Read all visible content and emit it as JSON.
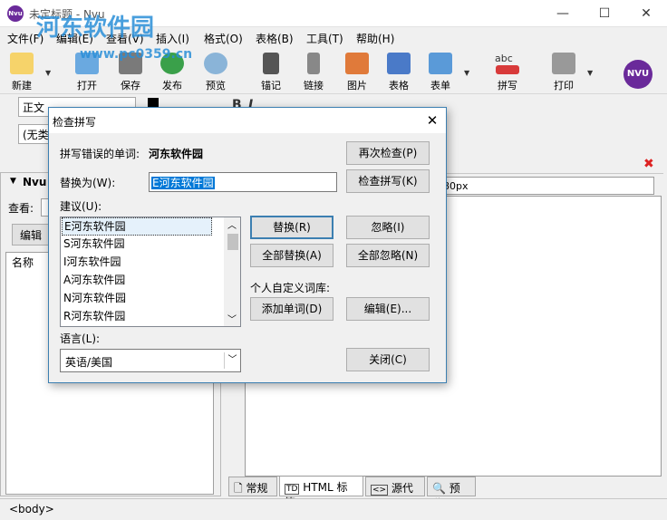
{
  "window": {
    "title": "未定标题 - Nvu",
    "logo": "Nvu",
    "minimize": "—",
    "maximize": "☐",
    "close": "✕"
  },
  "watermark": {
    "main": "河东软件园",
    "url": "www.pc0359.cn"
  },
  "menu": [
    "文件(F)",
    "编辑(E)",
    "查看(V)",
    "插入(I)",
    "格式(O)",
    "表格(B)",
    "工具(T)",
    "帮助(H)"
  ],
  "toolbar": [
    {
      "label": "新建",
      "icon": "new-page-icon",
      "color": "#f6d36a"
    },
    {
      "label": "打开",
      "icon": "open-folder-icon",
      "color": "#6aa9e0"
    },
    {
      "label": "保存",
      "icon": "save-disk-icon",
      "color": "#7a7a7a"
    },
    {
      "label": "发布",
      "icon": "publish-globe-icon",
      "color": "#3aa04a"
    },
    {
      "label": "预览",
      "icon": "preview-magnifier-icon",
      "color": "#8ab4d8"
    },
    {
      "label": "锚记",
      "icon": "anchor-icon",
      "color": "#555555"
    },
    {
      "label": "链接",
      "icon": "link-chain-icon",
      "color": "#888888"
    },
    {
      "label": "图片",
      "icon": "image-icon",
      "color": "#e07a3a"
    },
    {
      "label": "表格",
      "icon": "table-icon",
      "color": "#4a7ac8"
    },
    {
      "label": "表单",
      "icon": "form-icon",
      "color": "#5a9ad8"
    },
    {
      "label": "拼写",
      "icon": "spell-check-icon",
      "color": "#d83a3a"
    },
    {
      "label": "打印",
      "icon": "printer-icon",
      "color": "#999999"
    }
  ],
  "toolbar_extra": {
    "spell_abc": "abc",
    "nvu_logo": "NVU"
  },
  "format": {
    "paragraph_style": "正文",
    "second_style": "(无类",
    "bold": "B",
    "italic": "I"
  },
  "left_panel": {
    "title": "Nvu",
    "view_label": "查看:",
    "edit_button": "编辑",
    "column_name": "名称"
  },
  "editor": {
    "px_value": "80px"
  },
  "bottom_tabs": [
    "常规",
    "HTML 标签",
    "源代码",
    "预览"
  ],
  "status": {
    "tag": "<body>"
  },
  "dialog": {
    "title": "检查拼写",
    "misspelled_label": "拼写错误的单词:",
    "misspelled_word": "河东软件园",
    "replace_label": "替换为(W):",
    "replace_value": "E河东软件园",
    "suggestions_label": "建议(U):",
    "suggestions": [
      "E河东软件园",
      "S河东软件园",
      "I河东软件园",
      "A河东软件园",
      "N河东软件园",
      "R河东软件园"
    ],
    "language_label": "语言(L):",
    "language_value": "英语/美国",
    "custom_dict_label": "个人自定义词库:",
    "buttons": {
      "recheck": "再次检查(P)",
      "check": "检查拼写(K)",
      "replace": "替换(R)",
      "ignore": "忽略(I)",
      "replace_all": "全部替换(A)",
      "ignore_all": "全部忽略(N)",
      "add_word": "添加单词(D)",
      "edit": "编辑(E)...",
      "close": "关闭(C)"
    },
    "close_glyph": "✕"
  }
}
